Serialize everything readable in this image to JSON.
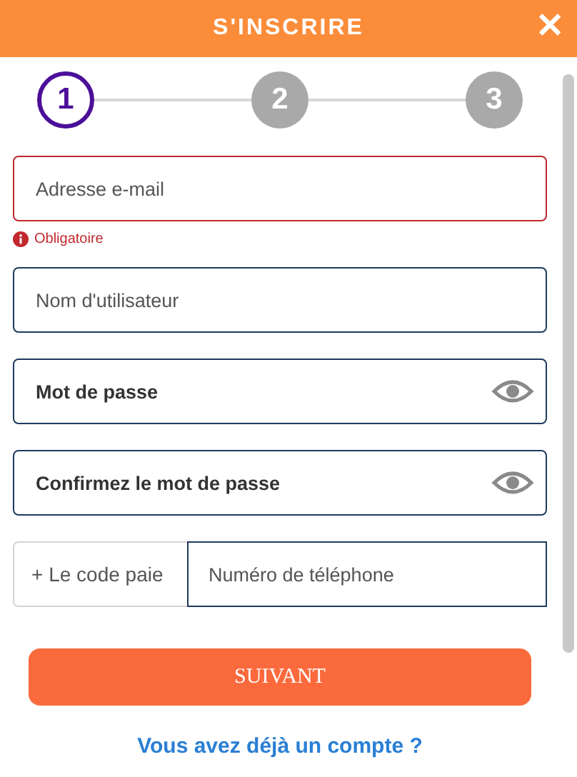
{
  "header": {
    "title": "S'INSCRIRE",
    "close": "✕"
  },
  "steps": [
    {
      "label": "1",
      "selected": true
    },
    {
      "label": "2",
      "selected": false
    },
    {
      "label": "3",
      "selected": false
    }
  ],
  "fields": [
    {
      "kind": "text",
      "placeholder": "Adresse e-mail",
      "error": true,
      "message": "Obligatoire"
    },
    {
      "kind": "text",
      "placeholder": "Nom d'utilisateur",
      "error": false
    },
    {
      "kind": "password",
      "placeholder": "Mot de passe",
      "error": false
    },
    {
      "kind": "password",
      "placeholder": "Confirmez le mot de passe",
      "error": false
    }
  ],
  "phone": {
    "code_prefix": "+",
    "code": "Le code paie",
    "placeholder": "Numéro de téléphone"
  },
  "next_button": "SUIVANT",
  "login_link": "Vous avez déjà un compte ?"
}
